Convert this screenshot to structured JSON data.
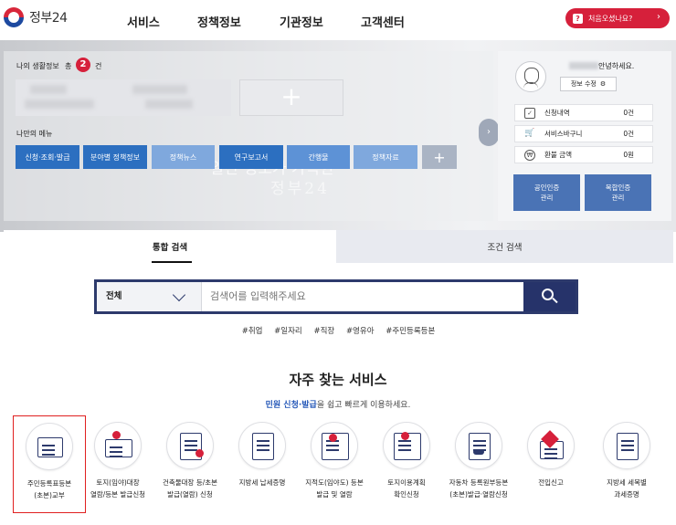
{
  "header": {
    "logo_text": "정부24",
    "nav": [
      "서비스",
      "정책정보",
      "기관정보",
      "고객센터"
    ],
    "first_visit_label": "처음오셨나요?",
    "first_visit_q": "?",
    "first_visit_arrow": "›"
  },
  "hero": {
    "life_info_label": "나의 생활정보",
    "life_info_total": "총",
    "life_info_count": "2",
    "life_info_unit": "건",
    "add_symbol": "+",
    "my_menu_label": "나만의 메뉴",
    "watermark_line1": "알찬 정보가 가득한",
    "watermark_line2": "정부24",
    "menu_buttons": [
      {
        "label": "신청·조회·발급",
        "color": "#2c6fc0"
      },
      {
        "label": "분야별 정책정보",
        "color": "#2c6fc0"
      },
      {
        "label": "정책뉴스",
        "color": "#7fa8dd"
      },
      {
        "label": "연구보고서",
        "color": "#2c6fc0"
      },
      {
        "label": "간행물",
        "color": "#5d92d6"
      },
      {
        "label": "정책자료",
        "color": "#7fa8dd"
      },
      {
        "label": "+",
        "color": "#aab4c4"
      }
    ],
    "slide_arrow": "›"
  },
  "user_panel": {
    "greeting": "안녕하세요.",
    "edit_label": "정보 수정",
    "edit_icon": "⚙",
    "stats": [
      {
        "icon": "✓",
        "icon_name": "checklist-icon",
        "label": "신청내역",
        "value": "0건"
      },
      {
        "icon": "🛒",
        "icon_name": "cart-icon",
        "label": "서비스바구니",
        "value": "0건"
      },
      {
        "icon": "₩",
        "icon_name": "won-icon",
        "label": "환불 금액",
        "value": "0원"
      }
    ],
    "cert_buttons": [
      "공인인증\n관리",
      "복합인증\n관리"
    ]
  },
  "search": {
    "tabs": [
      "통합 검색",
      "조건 검색"
    ],
    "scope": "전체",
    "placeholder": "검색어를 입력해주세요",
    "tags": [
      "#취업",
      "#일자리",
      "#직장",
      "#영유아",
      "#주민등록등본"
    ]
  },
  "frequent": {
    "title": "자주 찾는 서비스",
    "subtitle_highlight": "민원 신청·발급",
    "subtitle_rest": "을 쉽고 빠르게 이용하세요.",
    "services": [
      {
        "name": "주민등록표등본\n(초본)교부",
        "highlight": true
      },
      {
        "name": "토지(임야)대장\n열람/등본 발급신청",
        "highlight": false
      },
      {
        "name": "건축물대장 등/초본\n발급(열람) 신청",
        "highlight": false
      },
      {
        "name": "지방세 납세증명",
        "highlight": false
      },
      {
        "name": "지적도(임야도) 등본\n발급 및 열람",
        "highlight": false
      },
      {
        "name": "토지이용계획\n확인신청",
        "highlight": false
      },
      {
        "name": "자동차 등록원부등본\n(초본)발급·열람신청",
        "highlight": false
      },
      {
        "name": "전입신고",
        "highlight": false
      },
      {
        "name": "지방세 세목별\n과세증명",
        "highlight": false
      }
    ]
  }
}
